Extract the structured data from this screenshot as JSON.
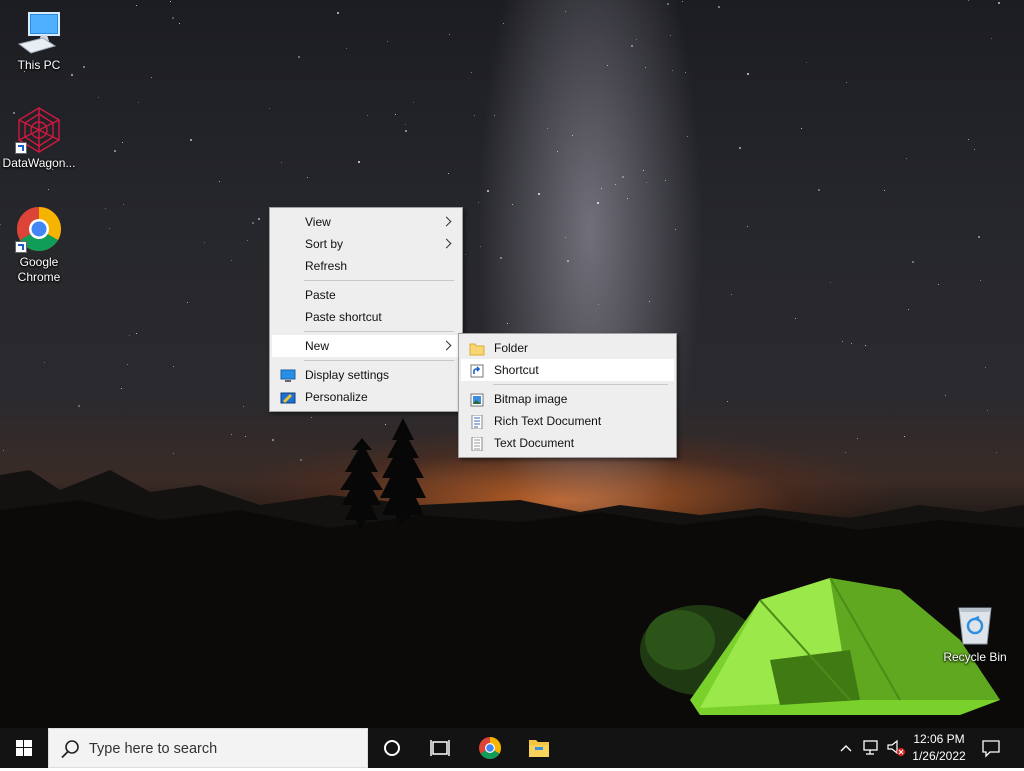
{
  "desktop": {
    "icons": [
      {
        "label": "This PC",
        "icon": "this-pc-icon"
      },
      {
        "label": "DataWagon...",
        "icon": "datawagon-icon"
      },
      {
        "label": "Google Chrome",
        "icon": "chrome-icon"
      },
      {
        "label": "Recycle Bin",
        "icon": "recycle-bin-icon"
      }
    ]
  },
  "context_menu": {
    "items": [
      {
        "label": "View",
        "submenu": true
      },
      {
        "label": "Sort by",
        "submenu": true
      },
      {
        "label": "Refresh"
      },
      {
        "label": "Paste"
      },
      {
        "label": "Paste shortcut"
      },
      {
        "label": "New",
        "submenu": true,
        "highlighted": true
      },
      {
        "label": "Display settings",
        "icon": "display-settings-icon"
      },
      {
        "label": "Personalize",
        "icon": "personalize-icon"
      }
    ]
  },
  "new_submenu": {
    "items": [
      {
        "label": "Folder",
        "icon": "folder-icon"
      },
      {
        "label": "Shortcut",
        "icon": "shortcut-icon",
        "highlighted": true
      },
      {
        "label": "Bitmap image",
        "icon": "bitmap-image-icon"
      },
      {
        "label": "Rich Text Document",
        "icon": "rich-text-document-icon"
      },
      {
        "label": "Text Document",
        "icon": "text-document-icon"
      }
    ]
  },
  "taskbar": {
    "search_placeholder": "Type here to search",
    "time": "12:06 PM",
    "date": "1/26/2022"
  },
  "colors": {
    "taskbar": "#131313",
    "menu_background": "#eeeeee",
    "menu_highlight": "#ffffff",
    "tent_green": "#8fe03a"
  }
}
